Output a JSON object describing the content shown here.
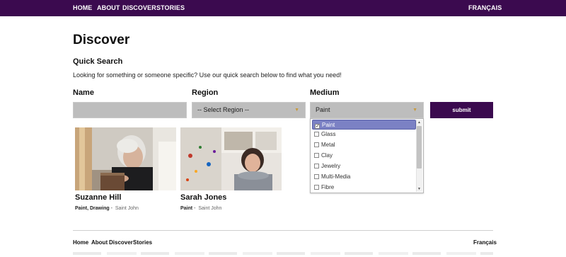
{
  "topnav": {
    "items": [
      "HOME",
      "ABOUT",
      "DISCOVER",
      "STORIES"
    ],
    "language": "FRANÇAIS",
    "bg_color": "#3b0a4f"
  },
  "page": {
    "title": "Discover",
    "quick_search_title": "Quick Search",
    "intro": "Looking for something or someone specific? Use our quick search below to find what you need!"
  },
  "form": {
    "name_label": "Name",
    "name_value": "",
    "region_label": "Region",
    "region_value": "-- Select Region --",
    "medium_label": "Medium",
    "medium_value": "Paint",
    "submit_label": "submit",
    "medium_options": [
      {
        "label": "Paint",
        "checked": true
      },
      {
        "label": "Glass",
        "checked": false
      },
      {
        "label": "Metal",
        "checked": false
      },
      {
        "label": "Clay",
        "checked": false
      },
      {
        "label": "Jewelry",
        "checked": false
      },
      {
        "label": "Multi-Media",
        "checked": false
      },
      {
        "label": "Fibre",
        "checked": false
      }
    ]
  },
  "results": [
    {
      "name": "Suzanne Hill",
      "medium": "Paint, Drawing",
      "separator": "-",
      "location": "Saint John"
    },
    {
      "name": "Sarah Jones",
      "medium": "Paint",
      "separator": "-",
      "location": "Saint John"
    }
  ],
  "footer": {
    "items": [
      "Home",
      "About",
      "Discover",
      "Stories"
    ],
    "language": "Français"
  }
}
